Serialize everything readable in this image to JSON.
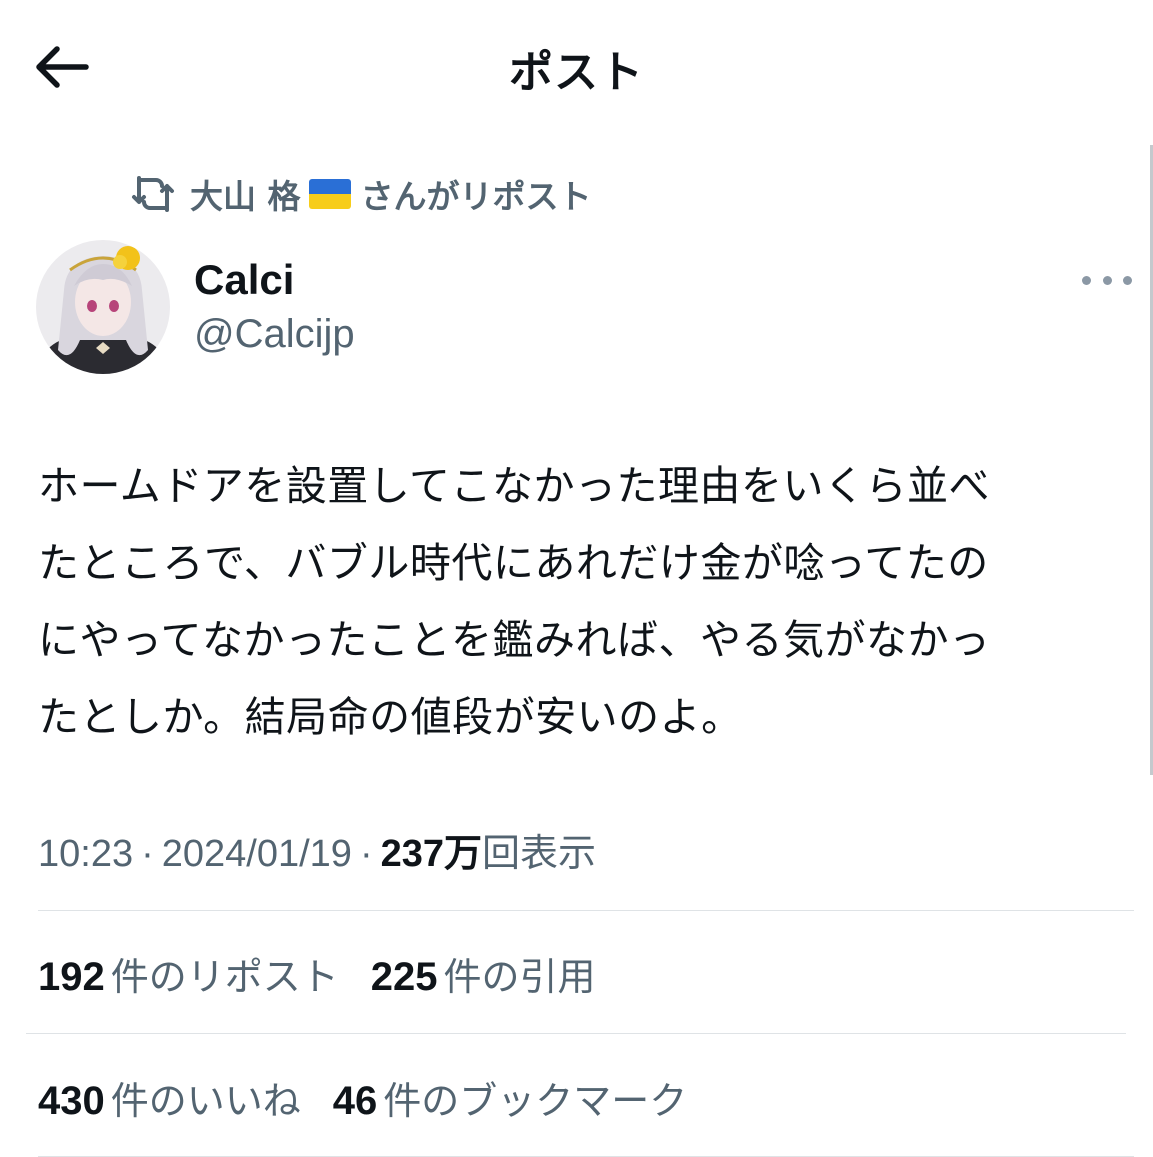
{
  "header": {
    "title": "ポスト"
  },
  "repost": {
    "reposter_name": "大山 格",
    "suffix": "さんがリポスト"
  },
  "author": {
    "display_name": "Calci",
    "handle": "@Calcijp"
  },
  "post": {
    "text": "ホームドアを設置してこなかった理由をいくら並べ\nたところで、バブル時代にあれだけ金が唸ってたの\nにやってなかったことを鑑みれば、やる気がなかっ\nたとしか。結局命の値段が安いのよ。",
    "time": "10:23",
    "date": "2024/01/19",
    "views_count": "237万",
    "views_label": "回表示",
    "separator": "·"
  },
  "stats": {
    "reposts": {
      "count": "192",
      "label": "件のリポスト"
    },
    "quotes": {
      "count": "225",
      "label": "件の引用"
    },
    "likes": {
      "count": "430",
      "label": "件のいいね"
    },
    "bookmarks": {
      "count": "46",
      "label": "件のブックマーク"
    }
  },
  "icons": {
    "back": "arrow-left-icon",
    "repost": "repost-icon",
    "more": "more-horizontal-icon",
    "flag": "ukraine-flag-icon"
  },
  "colors": {
    "text_primary": "#0f1419",
    "text_secondary": "#536471",
    "divider": "#dfe3e6",
    "flag_blue": "#2a6fd6",
    "flag_yellow": "#f7cd1b"
  }
}
